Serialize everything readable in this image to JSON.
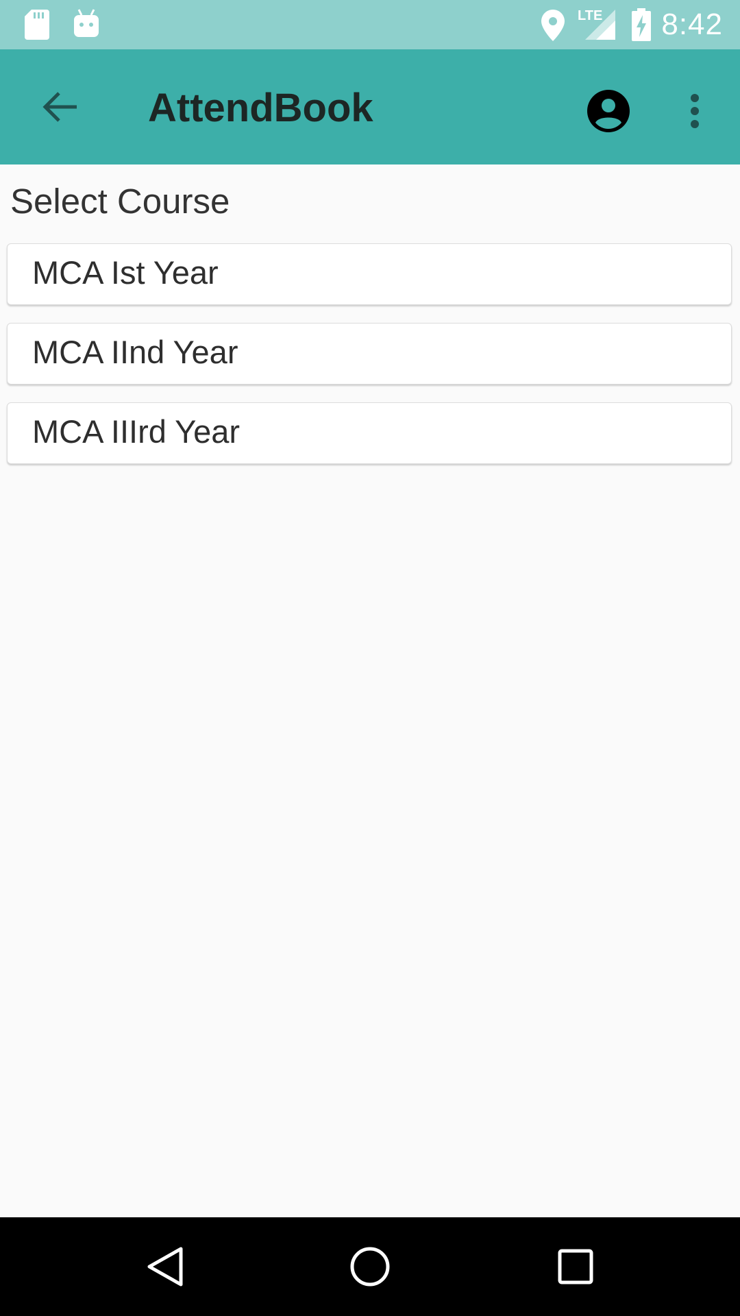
{
  "status_bar": {
    "time": "8:42",
    "network": "LTE",
    "icons": [
      "sd-card-icon",
      "android-icon",
      "location-icon",
      "signal-icon",
      "battery-charging-icon"
    ]
  },
  "app_bar": {
    "title": "AttendBook",
    "color": "#3dafa9",
    "icons": [
      "back-arrow-icon",
      "account-circle-icon",
      "more-vert-icon"
    ]
  },
  "main": {
    "section_title": "Select Course",
    "courses": [
      {
        "label": "MCA Ist Year"
      },
      {
        "label": "MCA IInd Year"
      },
      {
        "label": "MCA IIIrd Year"
      }
    ]
  },
  "nav_bar": {
    "icons": [
      "back-triangle-icon",
      "home-circle-icon",
      "recents-square-icon"
    ]
  }
}
